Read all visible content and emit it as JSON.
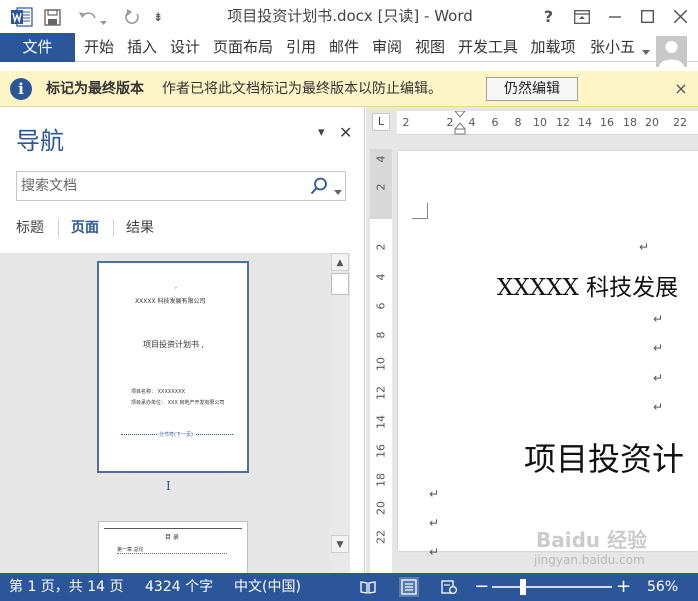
{
  "window": {
    "title": "项目投资计划书.docx [只读] - Word",
    "help_label": "?",
    "controls": [
      "ribbon-display-icon",
      "minimize-icon",
      "maximize-icon",
      "close-icon"
    ]
  },
  "quick_access": {
    "items": [
      "word-logo-icon",
      "save-icon",
      "undo-icon",
      "redo-icon",
      "customize-icon"
    ],
    "customize_glyph": "⇟"
  },
  "ribbon": {
    "file_tab": "文件",
    "tabs": [
      "开始",
      "插入",
      "设计",
      "页面布局",
      "引用",
      "邮件",
      "审阅",
      "视图",
      "开发工具",
      "加载项"
    ],
    "user_name": "张小五"
  },
  "message_bar": {
    "icon": "i",
    "title": "标记为最终版本",
    "text": "作者已将此文档标记为最终版本以防止编辑。",
    "button": "仍然编辑",
    "close": "×"
  },
  "nav_pane": {
    "title": "导航",
    "dropdown_glyph": "▾",
    "close_glyph": "✕",
    "search_placeholder": "搜索文档",
    "tabs": [
      {
        "label": "标题",
        "active": false
      },
      {
        "label": "页面",
        "active": true
      },
      {
        "label": "结果",
        "active": false
      }
    ],
    "thumbnail_1": {
      "dot": ",",
      "company": "XXXXX 科技发展有限公司",
      "title": "项目投资计划书 ,",
      "line_1": "项目名称： XXXXXXXX",
      "line_2": "项目承办单位： XXX 房地产开发有限公司",
      "section_break": "分节符(下一页)"
    },
    "thumbnail_2": {
      "title": "目 录",
      "line_1": "第一章 总论"
    },
    "page_marker": "I"
  },
  "document": {
    "ruler_corner": "L",
    "h_ruler_ticks": [
      "2",
      "2",
      "4",
      "6",
      "8",
      "10",
      "12",
      "14",
      "16",
      "18",
      "20",
      "22"
    ],
    "v_ruler_ticks": [
      "4",
      "2",
      "2",
      "4",
      "6",
      "8",
      "10",
      "12",
      "14",
      "16",
      "18",
      "20",
      "22"
    ],
    "paragraph_mark": "↵",
    "heading_1": "XXXXX 科技发展",
    "heading_2": "项目投资计"
  },
  "status_bar": {
    "page_info": "第 1 页，共 14 页",
    "word_count": "4324 个字",
    "language": "中文(中国)",
    "zoom_minus": "−",
    "zoom_plus": "+",
    "zoom_percent": "56%",
    "zoom_level": 0.56
  },
  "watermark": {
    "text": "Baidu 经验",
    "sub": "jingyan.baidu.com"
  },
  "colors": {
    "accent": "#2b579a",
    "message_bar": "#fdf5c6",
    "status_bar": "#2b579a"
  }
}
